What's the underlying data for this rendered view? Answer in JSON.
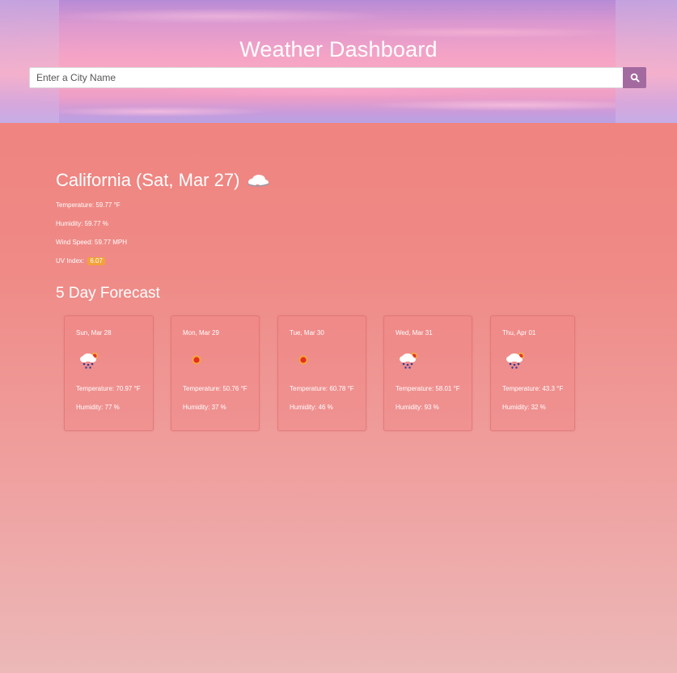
{
  "header": {
    "title": "Weather Dashboard",
    "search_placeholder": "Enter a City Name",
    "search_icon": "search-icon",
    "colors": {
      "search_button": "#a36aa0",
      "page_background": "#ef7f7b"
    }
  },
  "current": {
    "heading": "California (Sat, Mar 27)",
    "icon": "cloud-icon",
    "temperature": "Temperature: 59.77 °F",
    "humidity": "Humidity: 59.77 %",
    "wind_speed": "Wind Speed: 59.77 MPH",
    "uv_label": "UV Index:",
    "uv_value": "6.07",
    "uv_color": "#f3a23a"
  },
  "forecast": {
    "title": "5 Day Forecast",
    "days": [
      {
        "date": "Sun, Mar 28",
        "icon": "rain-snow-sun-icon",
        "temperature": "Temperature: 70.97 °F",
        "humidity": "Humidity: 77 %"
      },
      {
        "date": "Mon, Mar 29",
        "icon": "sun-icon",
        "temperature": "Temperature: 50.76 °F",
        "humidity": "Humidity: 37 %"
      },
      {
        "date": "Tue, Mar 30",
        "icon": "sun-icon",
        "temperature": "Temperature: 60.78 °F",
        "humidity": "Humidity: 46 %"
      },
      {
        "date": "Wed, Mar 31",
        "icon": "rain-snow-sun-icon",
        "temperature": "Temperature: 58.01 °F",
        "humidity": "Humidity: 93 %"
      },
      {
        "date": "Thu, Apr 01",
        "icon": "rain-snow-sun-icon",
        "temperature": "Temperature: 43.3 °F",
        "humidity": "Humidity: 32 %"
      }
    ]
  }
}
